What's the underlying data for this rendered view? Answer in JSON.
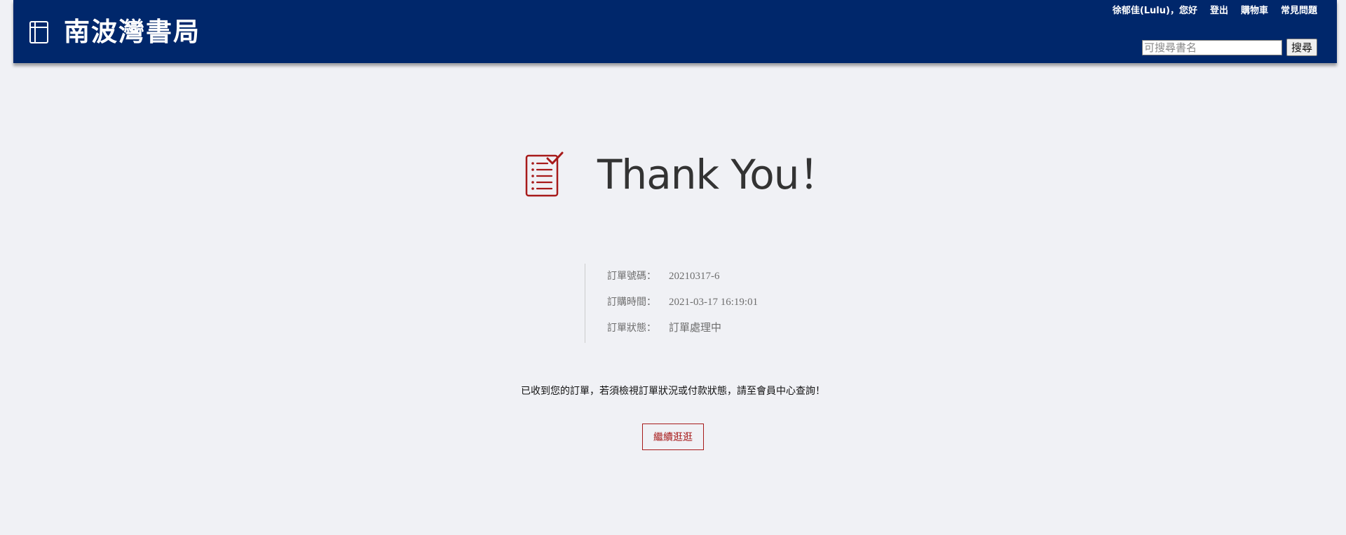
{
  "header": {
    "brand": "南波灣書局",
    "nav": {
      "greeting": "徐郁佳(Lulu)，您好",
      "logout": "登出",
      "cart": "購物車",
      "faq": "常見問題"
    },
    "search": {
      "placeholder": "可搜尋書名",
      "button_label": "搜尋"
    },
    "background_color": "#00276b"
  },
  "main": {
    "title": "Thank You！",
    "order": [
      {
        "label": "訂單號碼：",
        "value": "20210317-6"
      },
      {
        "label": "訂購時間：",
        "value": "2021-03-17 16:19:01"
      },
      {
        "label": "訂單狀態：",
        "value": "訂單處理中"
      }
    ],
    "message": "已收到您的訂單，若須檢視訂單狀況或付款狀態，請至會員中心查詢！",
    "continue_label": "繼續逛逛",
    "accent_color": "#a71a1a"
  },
  "icons": {
    "logo": "book-icon",
    "thanks": "checklist-icon"
  }
}
